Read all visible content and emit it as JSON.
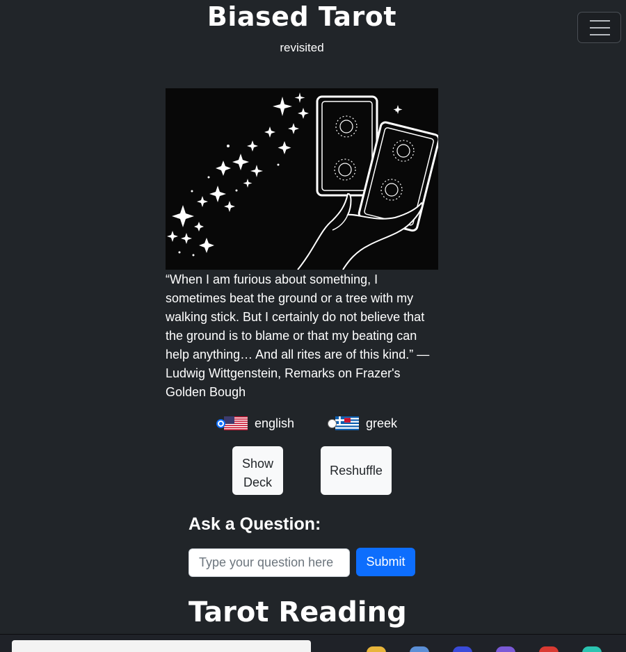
{
  "header": {
    "title": "Biased Tarot",
    "subtitle": "revisited",
    "menu_icon": "hamburger-menu-icon"
  },
  "hero_image": {
    "description_icon": "tarot-cards-hand-illustration"
  },
  "quote": "“When I am furious about something, I sometimes beat the ground or a tree with my walking stick. But I certainly do not believe that the ground is to blame or that my beating can help anything… And all rites are of this kind.” — Ludwig Wittgenstein, Remarks on Frazer's Golden Bough",
  "language": {
    "options": [
      {
        "label": "english",
        "flag": "us-flag-icon",
        "selected": true
      },
      {
        "label": "greek",
        "flag": "greek-flag-icon",
        "selected": false
      }
    ]
  },
  "actions": {
    "show_deck_line1": "Show",
    "show_deck_line2": "Deck",
    "reshuffle": "Reshuffle"
  },
  "question": {
    "label": "Ask a Question:",
    "placeholder": "Type your question here",
    "value": "",
    "submit": "Submit"
  },
  "reading": {
    "heading": "Tarot Reading"
  },
  "colors": {
    "background": "#212529",
    "primary": "#0d6efd",
    "light_button": "#f8f9fa"
  }
}
